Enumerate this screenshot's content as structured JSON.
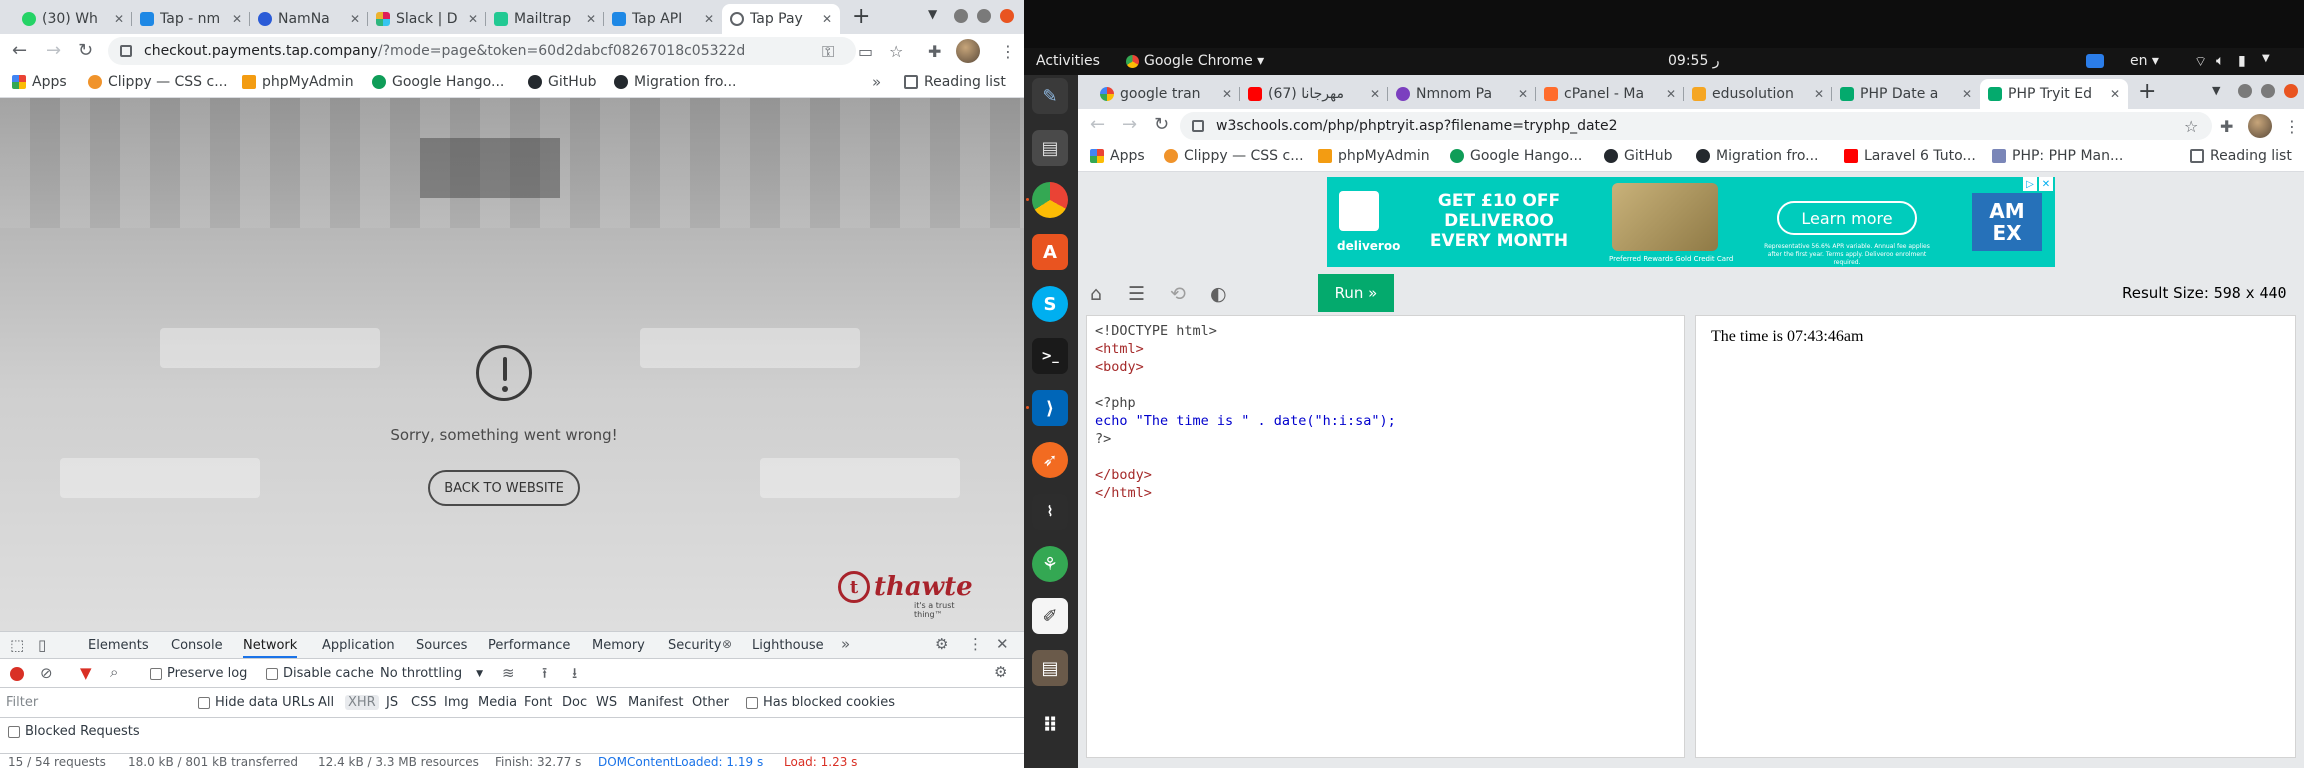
{
  "left": {
    "tabs": [
      {
        "label": "(30) Wh",
        "color": "#25d366"
      },
      {
        "label": "Tap - nm",
        "color": "#1e88e5"
      },
      {
        "label": "NamNa",
        "color": "#2a5bd7"
      },
      {
        "label": "Slack | D",
        "color": "#e01e5a"
      },
      {
        "label": "Mailtrap",
        "color": "#22c993"
      },
      {
        "label": "Tap API",
        "color": "#1e88e5"
      },
      {
        "label": "Tap Pay",
        "color": "#5f6368"
      }
    ],
    "url_host": "checkout.payments.tap.company",
    "url_path": "/?mode=page&token=60d2dabcf08267018c05322d",
    "bookmarks": [
      "Apps",
      "Clippy — CSS c...",
      "phpMyAdmin",
      "Google Hango...",
      "GitHub",
      "Migration fro..."
    ],
    "reading_list": "Reading list",
    "error_message": "Sorry, something went wrong!",
    "back_button": "BACK TO WEBSITE",
    "thawte": {
      "word": "thawte",
      "tagline": "it's a trust thing™",
      "letter": "t"
    },
    "devtools": {
      "tabs": [
        "Elements",
        "Console",
        "Network",
        "Application",
        "Sources",
        "Performance",
        "Memory",
        "Security",
        "Lighthouse"
      ],
      "active_tab": "Network",
      "preserve_log": "Preserve log",
      "disable_cache": "Disable cache",
      "throttling": "No throttling",
      "filter_placeholder": "Filter",
      "hide_data_urls": "Hide data URLs",
      "filter_types": [
        "All",
        "XHR",
        "JS",
        "CSS",
        "Img",
        "Media",
        "Font",
        "Doc",
        "WS",
        "Manifest",
        "Other"
      ],
      "has_blocked_cookies": "Has blocked cookies",
      "blocked_requests": "Blocked Requests",
      "status": {
        "requests": "15 / 54 requests",
        "transferred": "18.0 kB / 801 kB transferred",
        "resources": "12.4 kB / 3.3 MB resources",
        "finish": "Finish: 32.77 s",
        "dcl": "DOMContentLoaded: 1.19 s",
        "load": "Load: 1.23 s"
      }
    }
  },
  "right": {
    "topbar": {
      "activities": "Activities",
      "app": "Google Chrome ▾",
      "clock": "09:55 ر",
      "lang": "en ▾"
    },
    "tabs": [
      {
        "label": "google tran",
        "color": "#4285f4"
      },
      {
        "label": "(67) مهرجانا",
        "color": "#ff0000"
      },
      {
        "label": "Nmnom Pa",
        "color": "#7b3fbf"
      },
      {
        "label": "cPanel - Ma",
        "color": "#ff6c2c"
      },
      {
        "label": "edusolution",
        "color": "#f5a623"
      },
      {
        "label": "PHP Date a",
        "color": "#04aa6d"
      },
      {
        "label": "PHP Tryit Ed",
        "color": "#04aa6d"
      }
    ],
    "url": "w3schools.com/php/phptryit.asp?filename=tryphp_date2",
    "bookmarks": [
      "Apps",
      "Clippy — CSS c...",
      "phpMyAdmin",
      "Google Hango...",
      "GitHub",
      "Migration fro...",
      "Laravel 6 Tuto...",
      "PHP: PHP Man..."
    ],
    "reading_list": "Reading list",
    "ad": {
      "brand": "deliveroo",
      "headline": "GET £10 OFF DELIVEROO EVERY MONTH",
      "card_caption": "Preferred Rewards Gold Credit Card",
      "cta": "Learn more",
      "fine_print": "Representative 56.6% APR variable. Annual fee applies after the first year. Terms apply. Deliveroo enrolment required.",
      "amex": "AM EX"
    },
    "run_label": "Run »",
    "result_size_label": "Result Size:",
    "result_w": "598",
    "result_x": "x",
    "result_h": "440",
    "code": [
      "<!DOCTYPE html>",
      "<html>",
      "<body>",
      "",
      "<?php",
      "echo \"The time is \" . date(\"h:i:sa\");",
      "?>",
      "",
      "</body>",
      "</html>"
    ],
    "result": "The time is 07:43:46am"
  }
}
